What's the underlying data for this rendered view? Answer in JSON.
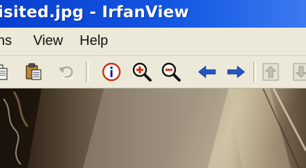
{
  "window": {
    "title": "isited.jpg - IrfanView"
  },
  "menu": {
    "items": [
      {
        "label": "ns"
      },
      {
        "label": "View"
      },
      {
        "label": "Help"
      }
    ]
  },
  "toolbar": {
    "buttons": [
      {
        "icon": "copy-icon",
        "enabled": true
      },
      {
        "icon": "paste-icon",
        "enabled": true
      },
      {
        "icon": "undo-icon",
        "enabled": false
      },
      {
        "icon": "info-icon",
        "enabled": true
      },
      {
        "icon": "zoom-in-icon",
        "enabled": true
      },
      {
        "icon": "zoom-out-icon",
        "enabled": true
      },
      {
        "icon": "previous-icon",
        "enabled": true
      },
      {
        "icon": "next-icon",
        "enabled": true
      },
      {
        "icon": "first-page-icon",
        "enabled": false
      },
      {
        "icon": "last-page-icon",
        "enabled": false
      }
    ]
  },
  "colors": {
    "titlebar": "#0a3fd0",
    "chrome": "#ece9d8",
    "arrow_blue": "#2456c8",
    "info_red": "#d42a10"
  }
}
